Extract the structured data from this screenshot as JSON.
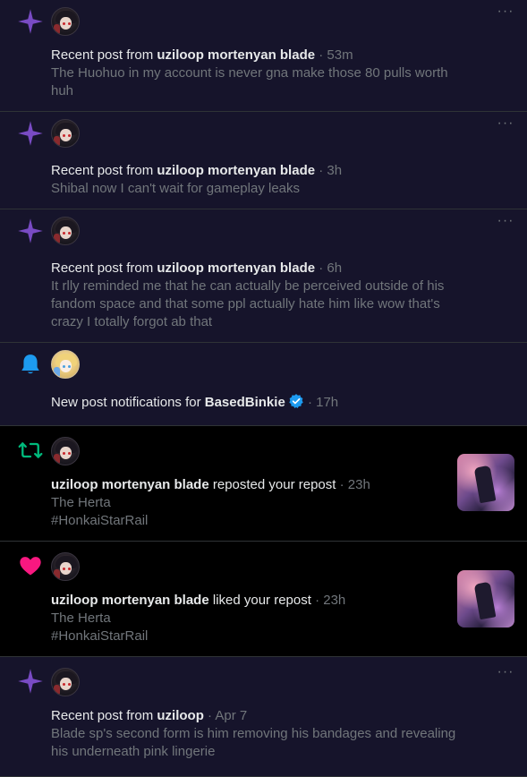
{
  "notifications": [
    {
      "type": "recent_post",
      "icon": "sparkle-icon",
      "prefix": "Recent post from ",
      "user": "uziloop mortenyan blade",
      "time": " · 53m",
      "text": "The Huohuo in my account is never gna make those 80 pulls worth huh",
      "more": "···"
    },
    {
      "type": "recent_post",
      "icon": "sparkle-icon",
      "prefix": "Recent post from ",
      "user": "uziloop mortenyan blade",
      "time": " · 3h",
      "text": "Shibal now I can't wait for gameplay leaks",
      "more": "···"
    },
    {
      "type": "recent_post",
      "icon": "sparkle-icon",
      "prefix": "Recent post from ",
      "user": "uziloop mortenyan blade",
      "time": " · 6h",
      "text": "It rlly reminded me that he can actually be perceived outside of his fandom space and that some ppl actually hate him like wow that's crazy I totally forgot ab that",
      "more": "···"
    },
    {
      "type": "post_notifications",
      "icon": "bell-icon",
      "prefix": "New post notifications for ",
      "user": "BasedBinkie",
      "time": " · 17h"
    },
    {
      "type": "repost",
      "icon": "repost-icon",
      "user": "uziloop mortenyan blade",
      "action": " reposted your repost",
      "time": " · 23h",
      "line1": "The Herta",
      "line2": "#HonkaiStarRail"
    },
    {
      "type": "like",
      "icon": "heart-icon",
      "user": "uziloop mortenyan blade",
      "action": " liked your repost",
      "time": " · 23h",
      "line1": "The Herta",
      "line2": "#HonkaiStarRail"
    },
    {
      "type": "recent_post",
      "icon": "sparkle-icon",
      "prefix": "Recent post from ",
      "user": "uziloop",
      "time": " · Apr 7",
      "text": "Blade sp's second form is him removing his bandages and revealing his underneath pink lingerie",
      "more": "···"
    }
  ],
  "colors": {
    "unread_bg": "#16142b",
    "sparkle": "#794bc4",
    "bell": "#1d9bf0",
    "repost": "#00ba7c",
    "heart": "#f91880",
    "verified": "#1d9bf0"
  }
}
